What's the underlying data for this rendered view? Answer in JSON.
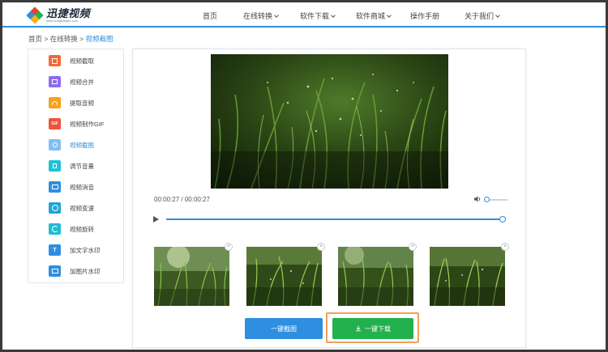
{
  "brand": {
    "name": "迅捷视频",
    "tagline": "www.xunjieshipin.com",
    "colors": {
      "primary": "#2e8fe0",
      "success": "#22b14c",
      "highlight": "#f0a05a"
    }
  },
  "nav": {
    "items": [
      {
        "label": "首页",
        "dropdown": false
      },
      {
        "label": "在线转换",
        "dropdown": true
      },
      {
        "label": "软件下载",
        "dropdown": true
      },
      {
        "label": "软件商城",
        "dropdown": true
      },
      {
        "label": "操作手册",
        "dropdown": false
      },
      {
        "label": "关于我们",
        "dropdown": true
      }
    ]
  },
  "breadcrumb": {
    "home": "首页",
    "sep1": ">",
    "section": "在线转换",
    "sep2": ">",
    "current": "视频截图"
  },
  "sidebar": {
    "items": [
      {
        "label": "视频截取",
        "icon": "crop-icon",
        "color": "#f06a3a"
      },
      {
        "label": "视频合并",
        "icon": "merge-icon",
        "color": "#8a6cf0"
      },
      {
        "label": "提取音频",
        "icon": "headphones-icon",
        "color": "#f6a21a"
      },
      {
        "label": "视频制作GIF",
        "icon": "gif-icon",
        "color": "#f0533a"
      },
      {
        "label": "视频截图",
        "icon": "scissors-icon",
        "color": "#3aa0f0",
        "active": true
      },
      {
        "label": "调节音量",
        "icon": "volume-icon",
        "color": "#1fc2d6"
      },
      {
        "label": "视频消音",
        "icon": "mute-video-icon",
        "color": "#2e8fe0"
      },
      {
        "label": "视频变速",
        "icon": "speed-icon",
        "color": "#1fa6d6"
      },
      {
        "label": "视频旋转",
        "icon": "rotate-icon",
        "color": "#1fbcd6"
      },
      {
        "label": "加文字水印",
        "icon": "text-watermark-icon",
        "color": "#2e8fe0"
      },
      {
        "label": "加图片水印",
        "icon": "image-watermark-icon",
        "color": "#2e8fe0"
      }
    ]
  },
  "player": {
    "current_time": "00:00:27",
    "separator": "/",
    "duration": "00:00:27",
    "progress": 1.0,
    "volume": 0.1
  },
  "screenshots": {
    "close_glyph": "×",
    "count": 4
  },
  "actions": {
    "screenshot_label": "一键截图",
    "download_label": "一键下载"
  }
}
